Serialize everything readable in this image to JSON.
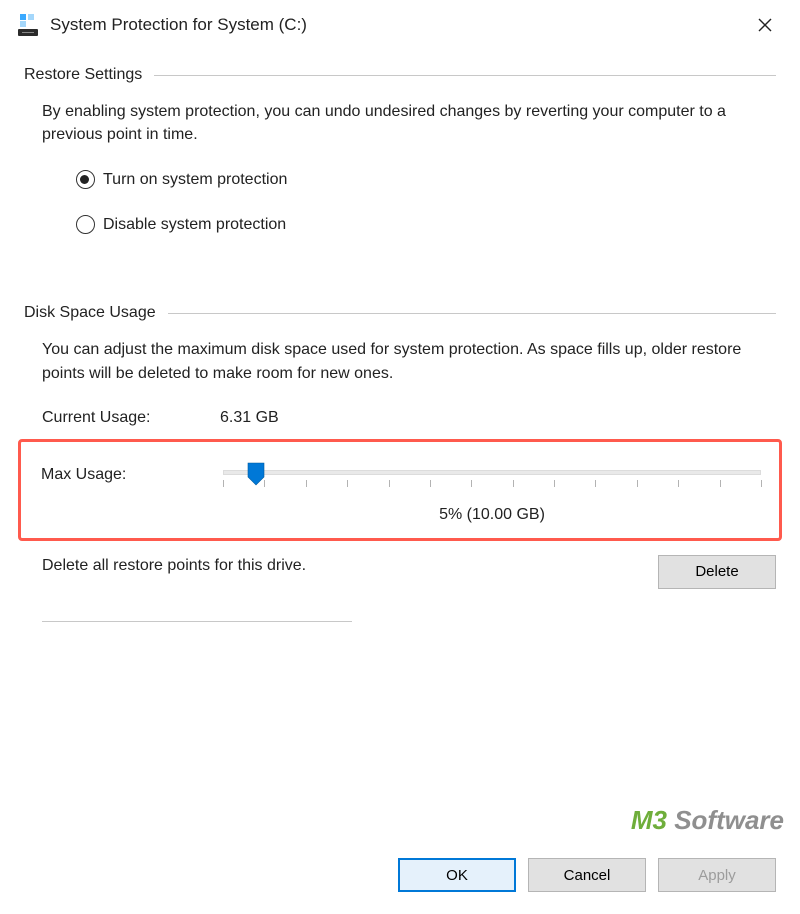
{
  "window": {
    "title": "System Protection for System (C:)"
  },
  "restore": {
    "section_label": "Restore Settings",
    "description": "By enabling system protection, you can undo undesired changes by reverting your computer to a previous point in time.",
    "option_on": "Turn on system protection",
    "option_off": "Disable system protection",
    "selected": "on"
  },
  "disk": {
    "section_label": "Disk Space Usage",
    "description": "You can adjust the maximum disk space used for system protection. As space fills up, older restore points will be deleted to make room for new ones.",
    "current_usage_label": "Current Usage:",
    "current_usage_value": "6.31 GB",
    "max_usage_label": "Max Usage:",
    "max_usage_value": "5% (10.00 GB)",
    "slider_percent": 5
  },
  "delete": {
    "text": "Delete all restore points for this drive.",
    "button": "Delete"
  },
  "buttons": {
    "ok": "OK",
    "cancel": "Cancel",
    "apply": "Apply"
  },
  "watermark": {
    "brand": "M3",
    "text": "Software"
  }
}
